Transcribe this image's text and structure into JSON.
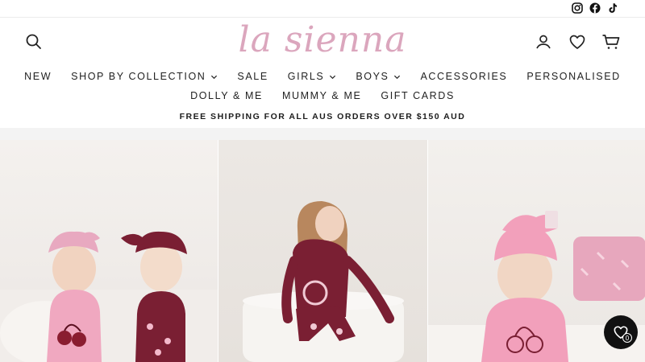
{
  "social": {
    "icons": [
      "instagram-icon",
      "facebook-icon",
      "tiktok-icon"
    ]
  },
  "header": {
    "logo_text": "la sienna",
    "icons": [
      "search-icon",
      "account-icon",
      "heart-icon",
      "cart-icon"
    ]
  },
  "nav": {
    "row1": [
      {
        "label": "NEW",
        "has_dropdown": false
      },
      {
        "label": "SHOP BY COLLECTION",
        "has_dropdown": true
      },
      {
        "label": "SALE",
        "has_dropdown": false
      },
      {
        "label": "GIRLS",
        "has_dropdown": true
      },
      {
        "label": "BOYS",
        "has_dropdown": true
      },
      {
        "label": "ACCESSORIES",
        "has_dropdown": false
      },
      {
        "label": "PERSONALISED",
        "has_dropdown": false
      }
    ],
    "row2": [
      {
        "label": "DOLLY & ME"
      },
      {
        "label": "MUMMY & ME"
      },
      {
        "label": "GIFT CARDS"
      }
    ]
  },
  "announcement": "FREE SHIPPING FOR ALL AUS ORDERS OVER $150 AUD",
  "wishlist_fab": {
    "count": "0"
  },
  "colors": {
    "brand_pink": "#dba6bd",
    "maroon": "#7a1f33",
    "light_pink": "#f0a8c0"
  }
}
